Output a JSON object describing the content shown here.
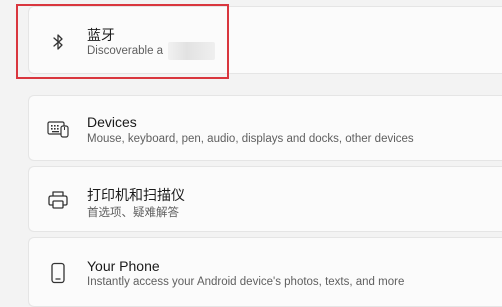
{
  "bluetooth": {
    "icon": "bluetooth-icon",
    "title": "蓝牙",
    "subtitle": "Discoverable a"
  },
  "devices": {
    "icon": "keyboard-devices-icon",
    "title": "Devices",
    "subtitle": "Mouse, keyboard, pen, audio, displays and docks, other devices"
  },
  "printers": {
    "icon": "printer-icon",
    "title": "打印机和扫描仪",
    "subtitle": "首选项、疑难解答"
  },
  "phone": {
    "icon": "phone-icon",
    "title": "Your Phone",
    "subtitle": "Instantly access your Android device's photos, texts, and more"
  },
  "colors": {
    "highlight_border": "#d9363e",
    "card_bg": "#fbfbfb",
    "page_bg": "#f3f3f3"
  }
}
